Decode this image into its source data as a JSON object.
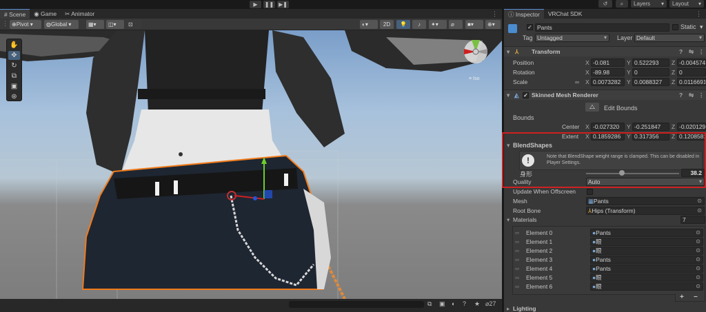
{
  "toolbar": {
    "play": "▶",
    "pause": "❚❚",
    "step": "▶❚",
    "history": "↺",
    "search": "⌕",
    "layers": "Layers",
    "layout": "Layout"
  },
  "scene_tabs": [
    {
      "icon": "#",
      "label": "Scene"
    },
    {
      "icon": "◉",
      "label": "Game"
    },
    {
      "icon": "✂",
      "label": "Animator"
    }
  ],
  "scene_bar": {
    "pivot": "Pivot",
    "global": "Global",
    "mode_2d": "2D",
    "iso": "≡ Iso",
    "bottom_count": "27"
  },
  "inspector": {
    "tabs": [
      "Inspector",
      "VRChat SDK"
    ],
    "object_name": "Pants",
    "static_label": "Static",
    "tag_label": "Tag",
    "tag_value": "Untagged",
    "layer_label": "Layer",
    "layer_value": "Default",
    "transform": {
      "title": "Transform",
      "position_label": "Position",
      "position": [
        "-0.081",
        "0.522293",
        "-0.004574"
      ],
      "rotation_label": "Rotation",
      "rotation": [
        "-89.98",
        "0",
        "0"
      ],
      "scale_label": "Scale",
      "scale": [
        "0.0073282",
        "0.0088327",
        "0.0116691"
      ]
    },
    "smr": {
      "title": "Skinned Mesh Renderer",
      "edit_bounds": "Edit Bounds",
      "bounds_label": "Bounds",
      "center_label": "Center",
      "center": [
        "-0.027320",
        "-0.251847",
        "-0.020129"
      ],
      "extent_label": "Extent",
      "extent": [
        "0.1859286",
        "0.317356",
        "0.1208581"
      ],
      "blendshapes_label": "BlendShapes",
      "note": "Note that BlendShape weight range is clamped. This can be disabled in Player Settings.",
      "shape_name": "身形",
      "shape_value": "38.2",
      "shape_level": 0.382,
      "quality_label": "Quality",
      "quality_value": "Auto",
      "update_offscreen_label": "Update When Offscreen",
      "mesh_label": "Mesh",
      "mesh_value": "Pants",
      "root_bone_label": "Root Bone",
      "root_bone_value": "Hips (Transform)",
      "materials_label": "Materials",
      "materials_count": "7",
      "elements": [
        {
          "label": "Element 0",
          "value": "Pants"
        },
        {
          "label": "Element 1",
          "value": "眼"
        },
        {
          "label": "Element 2",
          "value": "眼"
        },
        {
          "label": "Element 3",
          "value": "Pants"
        },
        {
          "label": "Element 4",
          "value": "Pants"
        },
        {
          "label": "Element 5",
          "value": "眼"
        },
        {
          "label": "Element 6",
          "value": "眼"
        }
      ],
      "add": "+",
      "remove": "−"
    },
    "lighting_label": "Lighting"
  },
  "colors": {
    "highlight": "#d02020",
    "selection": "#f07a1a",
    "accent": "#3d8ce0"
  }
}
